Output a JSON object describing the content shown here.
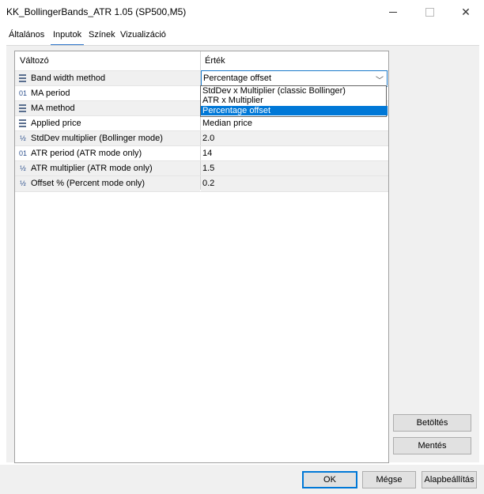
{
  "window": {
    "title": "KK_BollingerBands_ATR 1.05 (SP500,M5)",
    "min_icon": "minimize-icon",
    "max_icon": "maximize-icon",
    "close_glyph": "✕"
  },
  "tabs": [
    {
      "label": "Általános",
      "active": false
    },
    {
      "label": "Inputok",
      "active": true
    },
    {
      "label": "Színek",
      "active": false
    },
    {
      "label": "Vizualizáció",
      "active": false
    }
  ],
  "grid": {
    "header_var": "Változó",
    "header_val": "Érték",
    "rows": [
      {
        "icon": "enum-icon",
        "icon_glyph": "",
        "label": "Band width method",
        "value": "Percentage offset"
      },
      {
        "icon": "integer-icon",
        "icon_glyph": "01",
        "label": "MA period",
        "value": ""
      },
      {
        "icon": "enum-icon",
        "icon_glyph": "",
        "label": "MA method",
        "value": ""
      },
      {
        "icon": "enum-icon",
        "icon_glyph": "",
        "label": "Applied price",
        "value": "Median price"
      },
      {
        "icon": "double-icon",
        "icon_glyph": "½",
        "label": "StdDev multiplier (Bollinger mode)",
        "value": "2.0"
      },
      {
        "icon": "integer-icon",
        "icon_glyph": "01",
        "label": "ATR period (ATR mode only)",
        "value": "14"
      },
      {
        "icon": "double-icon",
        "icon_glyph": "½",
        "label": "ATR multiplier (ATR mode only)",
        "value": "1.5"
      },
      {
        "icon": "double-icon",
        "icon_glyph": "½",
        "label": "Offset % (Percent mode only)",
        "value": "0.2"
      }
    ]
  },
  "dropdown": {
    "chevron": "﹀",
    "options": [
      {
        "label": "StdDev x Multiplier (classic Bollinger)",
        "selected": false
      },
      {
        "label": "ATR x Multiplier",
        "selected": false
      },
      {
        "label": "Percentage offset",
        "selected": true
      }
    ]
  },
  "side_buttons": {
    "load": "Betöltés",
    "save": "Mentés"
  },
  "bottom_buttons": {
    "ok": "OK",
    "cancel": "Mégse",
    "reset": "Alapbeállítás"
  }
}
